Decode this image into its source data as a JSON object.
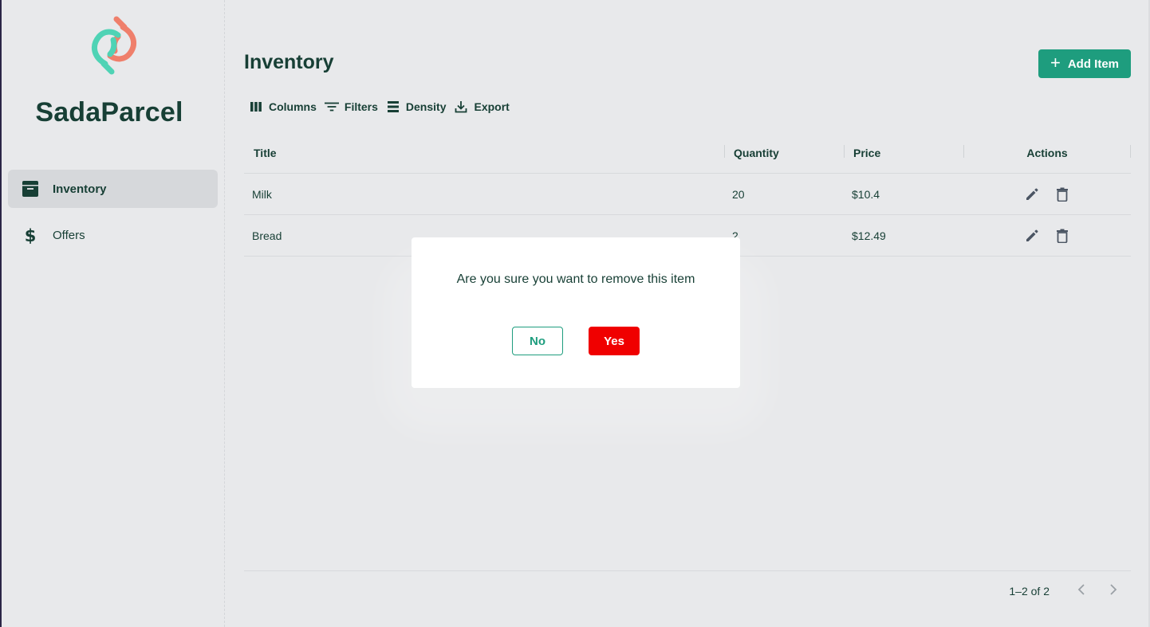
{
  "brand": {
    "name": "SadaParcel",
    "logo_icon": "sadaparcel-logo-icon",
    "colors": {
      "teal": "#4fd3b5",
      "coral": "#ef7f6b"
    }
  },
  "sidebar": {
    "items": [
      {
        "label": "Inventory",
        "icon": "archive-box-icon",
        "active": true
      },
      {
        "label": "Offers",
        "icon": "dollar-sign-icon",
        "active": false
      }
    ]
  },
  "header": {
    "title": "Inventory",
    "add_button": {
      "label": "Add Item",
      "icon": "plus-icon"
    }
  },
  "toolbar": {
    "columns": "Columns",
    "filters": "Filters",
    "density": "Density",
    "export": "Export"
  },
  "table": {
    "columns": [
      "Title",
      "Quantity",
      "Price",
      "Actions"
    ],
    "rows": [
      {
        "title": "Milk",
        "quantity": "20",
        "price": "$10.4"
      },
      {
        "title": "Bread",
        "quantity": "2",
        "price": "$12.49"
      }
    ]
  },
  "pagination": {
    "range": "1–2 of 2"
  },
  "dialog": {
    "message": "Are you sure you want to remove this item",
    "no_label": "No",
    "yes_label": "Yes"
  },
  "colors": {
    "accent": "#1e9d7e",
    "danger": "#f00000",
    "text": "#173f35"
  }
}
